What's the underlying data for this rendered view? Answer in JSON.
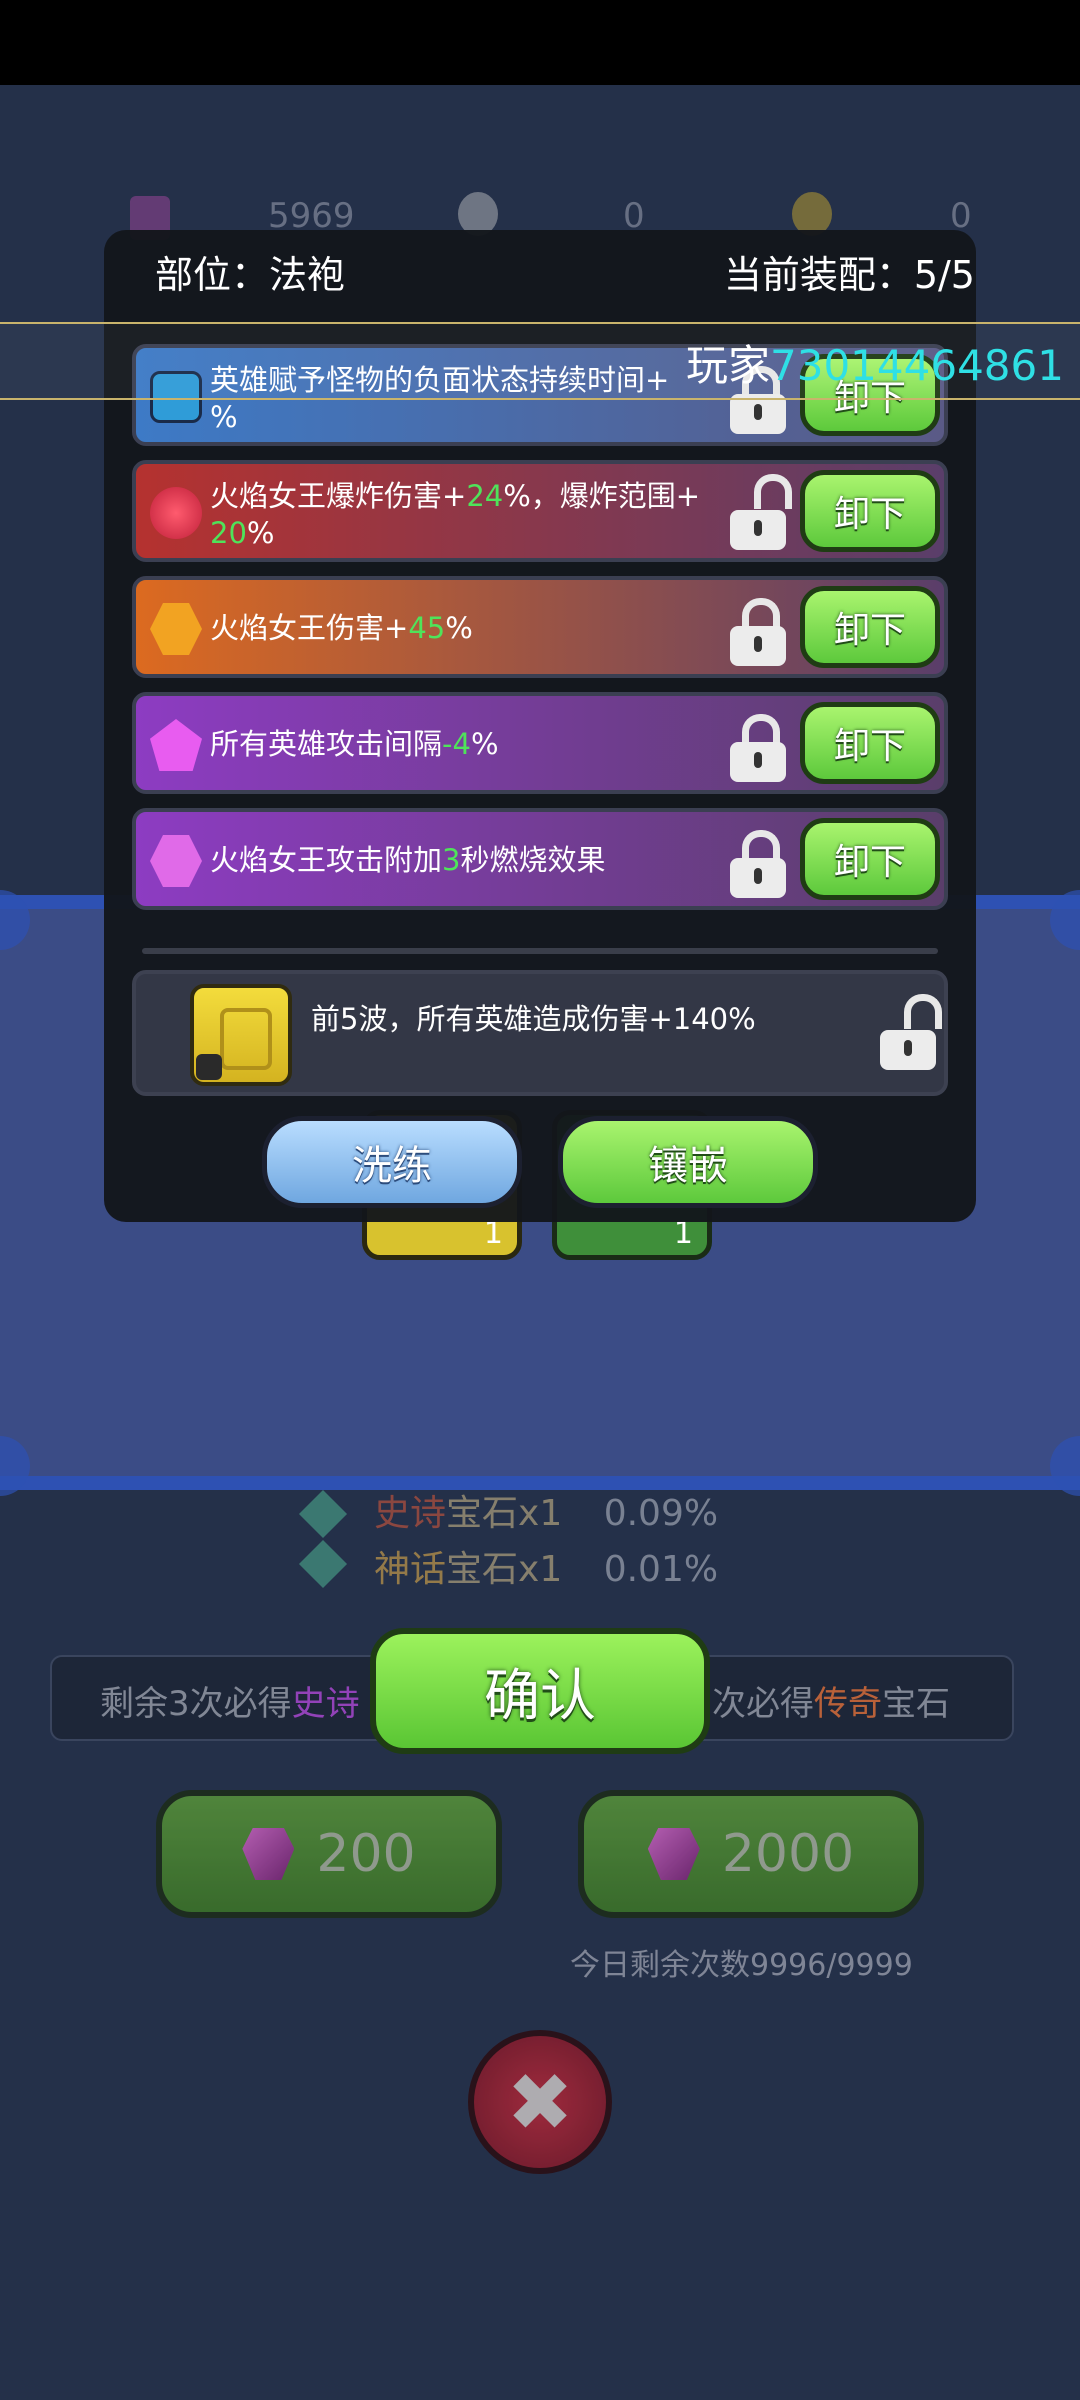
{
  "currencies": [
    {
      "icon": "pink-gem-icon",
      "value": "5969"
    },
    {
      "icon": "white-flower-icon",
      "value": "0"
    },
    {
      "icon": "gold-flower-icon",
      "value": "0"
    }
  ],
  "background": {
    "gem_line_1": {
      "rarity": "史诗",
      "label": "宝石x1",
      "pct": "0.09%"
    },
    "gem_line_2": {
      "rarity": "神话",
      "label": "宝石x1",
      "pct": "0.01%"
    },
    "hint_left": "剩余3次必得",
    "hint_left_rarity": "史诗",
    "hint_right": "次必得",
    "hint_right_rarity": "传奇",
    "hint_right_tail": "宝石",
    "confirm_label": "确认",
    "buy_1": "200",
    "buy_10": "2000",
    "today_left": "今日剩余次数9996/9999",
    "slot_count_1": "1",
    "slot_count_2": "1"
  },
  "modal": {
    "position_label": "部位：法袍",
    "equip_count": "当前装配：5/5",
    "rows": [
      {
        "icon": "blue-gem-icon",
        "text_a": "英雄赋予怪物的负面状态持续时间+",
        "green": "",
        "text_b": "%",
        "unload": "卸下"
      },
      {
        "icon": "red-gem-icon",
        "text_a": "火焰女王爆炸伤害+",
        "green": "24",
        "text_b": "%，爆炸范围+",
        "green2": "20",
        "text_c": "%",
        "unload": "卸下"
      },
      {
        "icon": "orange-gem-icon",
        "text_a": "火焰女王伤害+",
        "green": "45",
        "text_b": "%",
        "unload": "卸下"
      },
      {
        "icon": "purple-gem-icon",
        "text_a": "所有英雄攻击间隔",
        "green": "-4",
        "text_b": "%",
        "unload": "卸下"
      },
      {
        "icon": "pink-gem-icon",
        "text_a": "火焰女王攻击附加",
        "green": "3",
        "text_b": "秒燃烧效果",
        "unload": "卸下"
      }
    ],
    "item_effect": "前5波，所有英雄造成伤害+140%",
    "refine_label": "洗练",
    "inlay_label": "镶嵌"
  },
  "player": {
    "prefix": "玩家",
    "id": "73014464861"
  }
}
